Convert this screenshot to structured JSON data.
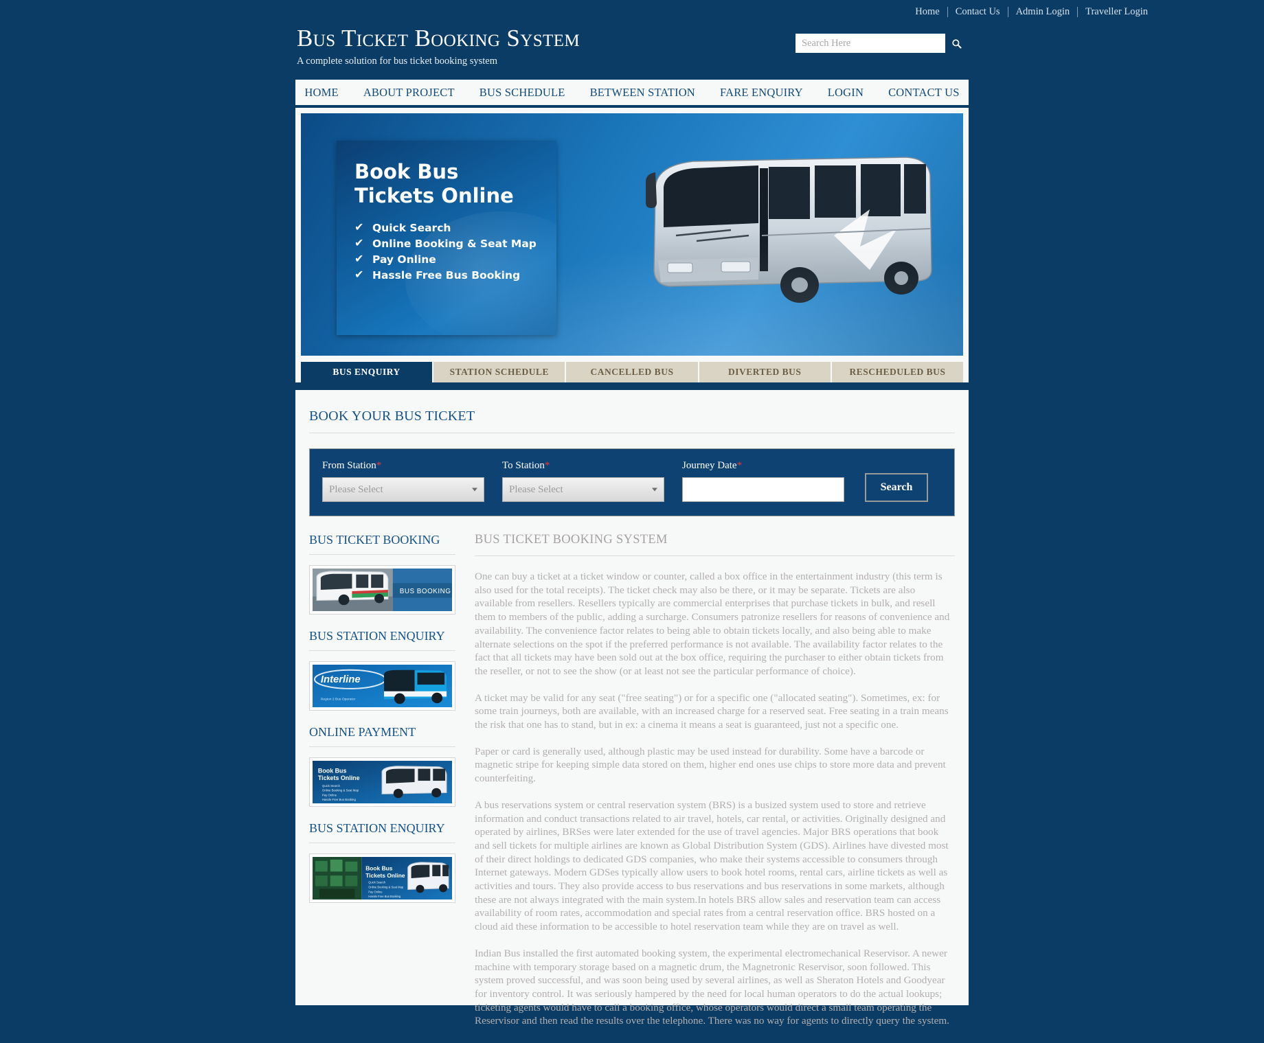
{
  "colors": {
    "page_bg": "#0b3c66",
    "content_bg": "#f7f8f8",
    "accent_blue": "#15528a",
    "tab_inactive": "#d9d4c3",
    "required_red": "#e23c3c"
  },
  "topnav": {
    "items": [
      {
        "label": "Home"
      },
      {
        "label": "Contact Us"
      },
      {
        "label": "Admin Login"
      },
      {
        "label": "Traveller Login"
      }
    ]
  },
  "header": {
    "title": "Bus Ticket Booking System",
    "subtitle": "A complete solution for bus ticket booking system",
    "search": {
      "placeholder": "Search Here",
      "value": "",
      "icon": "search-icon"
    }
  },
  "mainnav": {
    "items": [
      {
        "label": "HOME"
      },
      {
        "label": "ABOUT PROJECT"
      },
      {
        "label": "BUS SCHEDULE"
      },
      {
        "label": "BETWEEN STATION"
      },
      {
        "label": "FARE ENQUIRY"
      },
      {
        "label": "LOGIN"
      },
      {
        "label": "CONTACT US"
      }
    ]
  },
  "banner": {
    "promo_line1": "Book Bus",
    "promo_line2": "Tickets Online",
    "features": [
      {
        "label": "Quick Search"
      },
      {
        "label": "Online Booking & Seat Map"
      },
      {
        "label": "Pay Online"
      },
      {
        "label": "Hassle Free Bus Booking"
      }
    ],
    "check_glyph": "✔",
    "photo_alt": "coach-bus-photo"
  },
  "tabs": {
    "items": [
      {
        "label": "BUS ENQUIRY",
        "active": true
      },
      {
        "label": "STATION SCHEDULE",
        "active": false
      },
      {
        "label": "CANCELLED BUS",
        "active": false
      },
      {
        "label": "DIVERTED BUS",
        "active": false
      },
      {
        "label": "RESCHEDULED BUS",
        "active": false
      }
    ]
  },
  "booking_form": {
    "section_title": "BOOK YOUR BUS TICKET",
    "from_station": {
      "label": "From Station",
      "required": "*",
      "value": "Please Select"
    },
    "to_station": {
      "label": "To Station",
      "required": "*",
      "value": "Please Select"
    },
    "journey_date": {
      "label": "Journey Date",
      "required": "*",
      "value": "",
      "placeholder": ""
    },
    "submit_label": "Search"
  },
  "sidebar": {
    "blocks": [
      {
        "heading": "BUS TICKET BOOKING",
        "image_caption": "BUS BOOKING"
      },
      {
        "heading": "BUS STATION ENQUIRY",
        "image_caption": "Interline"
      },
      {
        "heading": "ONLINE PAYMENT",
        "image_caption": "Book Bus Tickets Online"
      },
      {
        "heading": "BUS STATION ENQUIRY",
        "image_caption": "Book Bus Tickets Online"
      }
    ],
    "image2_sub": "Region 2 Bus Operator"
  },
  "article": {
    "heading": "BUS TICKET BOOKING SYSTEM",
    "paragraphs": [
      "One can buy a ticket at a ticket window or counter, called a box office in the entertainment industry (this term is also used for the total receipts). The ticket check may also be there, or it may be separate. Tickets are also available from resellers. Resellers typically are commercial enterprises that purchase tickets in bulk, and resell them to members of the public, adding a surcharge. Consumers patronize resellers for reasons of convenience and availability. The convenience factor relates to being able to obtain tickets locally, and also being able to make alternate selections on the spot if the preferred performance is not available. The availability factor relates to the fact that all tickets may have been sold out at the box office, requiring the purchaser to either obtain tickets from the reseller, or not to see the show (or at least not see the particular performance of choice).",
      "A ticket may be valid for any seat (\"free seating\") or for a specific one (\"allocated seating\"). Sometimes, ex: for some train journeys, both are available, with an increased charge for a reserved seat. Free seating in a train means the risk that one has to stand, but in ex: a cinema it means a seat is guaranteed, just not a specific one.",
      "Paper or card is generally used, although plastic may be used instead for durability. Some have a barcode or magnetic stripe for keeping simple data stored on them, higher end ones use chips to store more data and prevent counterfeiting.",
      "A bus reservations system or central reservation system (BRS) is a busized system used to store and retrieve information and conduct transactions related to air travel, hotels, car rental, or activities. Originally designed and operated by airlines, BRSes were later extended for the use of travel agencies. Major BRS operations that book and sell tickets for multiple airlines are known as Global Distribution System (GDS). Airlines have divested most of their direct holdings to dedicated GDS companies, who make their systems accessible to consumers through Internet gateways. Modern GDSes typically allow users to book hotel rooms, rental cars, airline tickets as well as activities and tours. They also provide access to bus reservations and bus reservations in some markets, although these are not always integrated with the main system.In hotels BRS allow sales and reservation team can access availability of room rates, accommodation and special rates from a central reservation office. BRS hosted on a cloud aid these information to be accessible to hotel reservation team while they are on travel as well.",
      "Indian Bus installed the first automated booking system, the experimental electromechanical Reservisor. A newer machine with temporary storage based on a magnetic drum, the Magnetronic Reservisor, soon followed. This system proved successful, and was soon being used by several airlines, as well as Sheraton Hotels and Goodyear for inventory control. It was seriously hampered by the need for local human operators to do the actual lookups; ticketing agents would have to call a booking office, whose operators would direct a small team operating the Reservisor and then read the results over the telephone. There was no way for agents to directly query the system."
    ]
  }
}
